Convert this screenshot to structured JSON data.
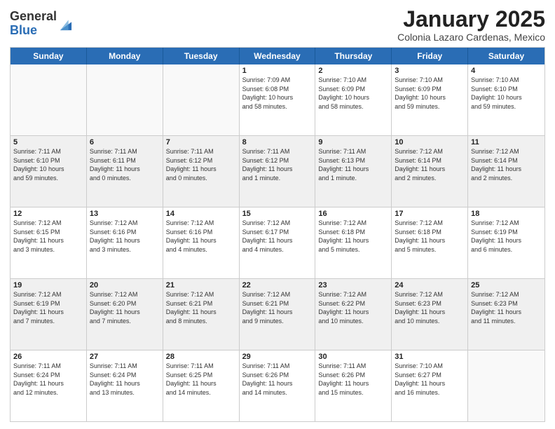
{
  "header": {
    "logo_general": "General",
    "logo_blue": "Blue",
    "month_title": "January 2025",
    "subtitle": "Colonia Lazaro Cardenas, Mexico"
  },
  "days_of_week": [
    "Sunday",
    "Monday",
    "Tuesday",
    "Wednesday",
    "Thursday",
    "Friday",
    "Saturday"
  ],
  "weeks": [
    [
      {
        "num": "",
        "info": "",
        "empty": true
      },
      {
        "num": "",
        "info": "",
        "empty": true
      },
      {
        "num": "",
        "info": "",
        "empty": true
      },
      {
        "num": "1",
        "info": "Sunrise: 7:09 AM\nSunset: 6:08 PM\nDaylight: 10 hours\nand 58 minutes.",
        "empty": false
      },
      {
        "num": "2",
        "info": "Sunrise: 7:10 AM\nSunset: 6:09 PM\nDaylight: 10 hours\nand 58 minutes.",
        "empty": false
      },
      {
        "num": "3",
        "info": "Sunrise: 7:10 AM\nSunset: 6:09 PM\nDaylight: 10 hours\nand 59 minutes.",
        "empty": false
      },
      {
        "num": "4",
        "info": "Sunrise: 7:10 AM\nSunset: 6:10 PM\nDaylight: 10 hours\nand 59 minutes.",
        "empty": false
      }
    ],
    [
      {
        "num": "5",
        "info": "Sunrise: 7:11 AM\nSunset: 6:10 PM\nDaylight: 10 hours\nand 59 minutes.",
        "empty": false
      },
      {
        "num": "6",
        "info": "Sunrise: 7:11 AM\nSunset: 6:11 PM\nDaylight: 11 hours\nand 0 minutes.",
        "empty": false
      },
      {
        "num": "7",
        "info": "Sunrise: 7:11 AM\nSunset: 6:12 PM\nDaylight: 11 hours\nand 0 minutes.",
        "empty": false
      },
      {
        "num": "8",
        "info": "Sunrise: 7:11 AM\nSunset: 6:12 PM\nDaylight: 11 hours\nand 1 minute.",
        "empty": false
      },
      {
        "num": "9",
        "info": "Sunrise: 7:11 AM\nSunset: 6:13 PM\nDaylight: 11 hours\nand 1 minute.",
        "empty": false
      },
      {
        "num": "10",
        "info": "Sunrise: 7:12 AM\nSunset: 6:14 PM\nDaylight: 11 hours\nand 2 minutes.",
        "empty": false
      },
      {
        "num": "11",
        "info": "Sunrise: 7:12 AM\nSunset: 6:14 PM\nDaylight: 11 hours\nand 2 minutes.",
        "empty": false
      }
    ],
    [
      {
        "num": "12",
        "info": "Sunrise: 7:12 AM\nSunset: 6:15 PM\nDaylight: 11 hours\nand 3 minutes.",
        "empty": false
      },
      {
        "num": "13",
        "info": "Sunrise: 7:12 AM\nSunset: 6:16 PM\nDaylight: 11 hours\nand 3 minutes.",
        "empty": false
      },
      {
        "num": "14",
        "info": "Sunrise: 7:12 AM\nSunset: 6:16 PM\nDaylight: 11 hours\nand 4 minutes.",
        "empty": false
      },
      {
        "num": "15",
        "info": "Sunrise: 7:12 AM\nSunset: 6:17 PM\nDaylight: 11 hours\nand 4 minutes.",
        "empty": false
      },
      {
        "num": "16",
        "info": "Sunrise: 7:12 AM\nSunset: 6:18 PM\nDaylight: 11 hours\nand 5 minutes.",
        "empty": false
      },
      {
        "num": "17",
        "info": "Sunrise: 7:12 AM\nSunset: 6:18 PM\nDaylight: 11 hours\nand 5 minutes.",
        "empty": false
      },
      {
        "num": "18",
        "info": "Sunrise: 7:12 AM\nSunset: 6:19 PM\nDaylight: 11 hours\nand 6 minutes.",
        "empty": false
      }
    ],
    [
      {
        "num": "19",
        "info": "Sunrise: 7:12 AM\nSunset: 6:19 PM\nDaylight: 11 hours\nand 7 minutes.",
        "empty": false
      },
      {
        "num": "20",
        "info": "Sunrise: 7:12 AM\nSunset: 6:20 PM\nDaylight: 11 hours\nand 7 minutes.",
        "empty": false
      },
      {
        "num": "21",
        "info": "Sunrise: 7:12 AM\nSunset: 6:21 PM\nDaylight: 11 hours\nand 8 minutes.",
        "empty": false
      },
      {
        "num": "22",
        "info": "Sunrise: 7:12 AM\nSunset: 6:21 PM\nDaylight: 11 hours\nand 9 minutes.",
        "empty": false
      },
      {
        "num": "23",
        "info": "Sunrise: 7:12 AM\nSunset: 6:22 PM\nDaylight: 11 hours\nand 10 minutes.",
        "empty": false
      },
      {
        "num": "24",
        "info": "Sunrise: 7:12 AM\nSunset: 6:23 PM\nDaylight: 11 hours\nand 10 minutes.",
        "empty": false
      },
      {
        "num": "25",
        "info": "Sunrise: 7:12 AM\nSunset: 6:23 PM\nDaylight: 11 hours\nand 11 minutes.",
        "empty": false
      }
    ],
    [
      {
        "num": "26",
        "info": "Sunrise: 7:11 AM\nSunset: 6:24 PM\nDaylight: 11 hours\nand 12 minutes.",
        "empty": false
      },
      {
        "num": "27",
        "info": "Sunrise: 7:11 AM\nSunset: 6:24 PM\nDaylight: 11 hours\nand 13 minutes.",
        "empty": false
      },
      {
        "num": "28",
        "info": "Sunrise: 7:11 AM\nSunset: 6:25 PM\nDaylight: 11 hours\nand 14 minutes.",
        "empty": false
      },
      {
        "num": "29",
        "info": "Sunrise: 7:11 AM\nSunset: 6:26 PM\nDaylight: 11 hours\nand 14 minutes.",
        "empty": false
      },
      {
        "num": "30",
        "info": "Sunrise: 7:11 AM\nSunset: 6:26 PM\nDaylight: 11 hours\nand 15 minutes.",
        "empty": false
      },
      {
        "num": "31",
        "info": "Sunrise: 7:10 AM\nSunset: 6:27 PM\nDaylight: 11 hours\nand 16 minutes.",
        "empty": false
      },
      {
        "num": "",
        "info": "",
        "empty": true
      }
    ]
  ]
}
